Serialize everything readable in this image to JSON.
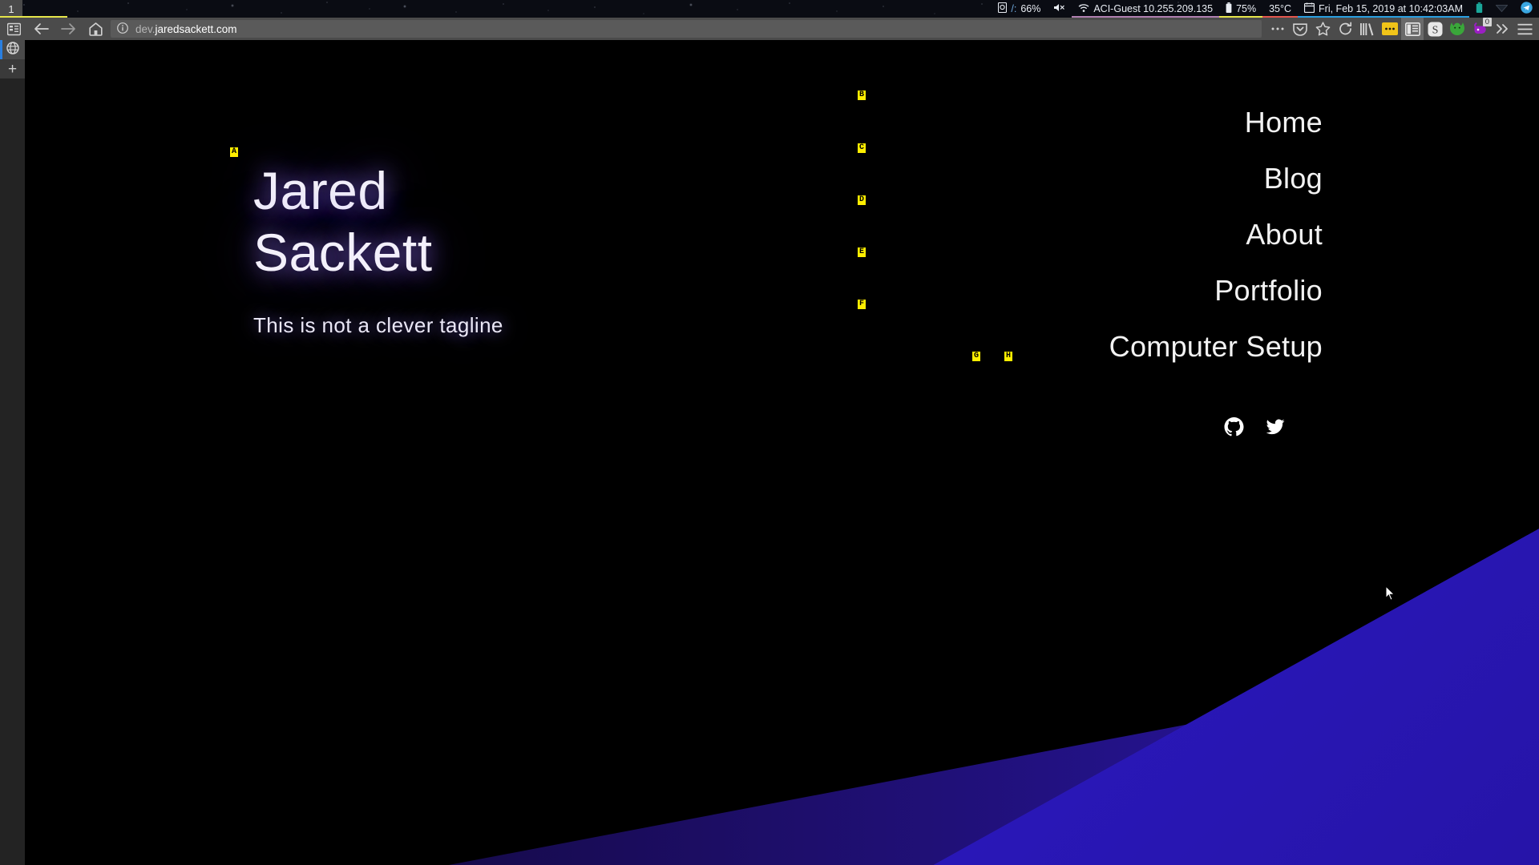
{
  "system_bar": {
    "workspace": "1",
    "modules": [
      {
        "name": "disk",
        "icon": "disk-icon",
        "prefix": "/:",
        "text": "66%",
        "underline": ""
      },
      {
        "name": "volume-muted",
        "icon": "speaker-muted-icon",
        "text": "",
        "underline": ""
      },
      {
        "name": "network",
        "icon": "wifi-icon",
        "text": "ACI-Guest 10.255.209.135",
        "underline": "#b07fb0"
      },
      {
        "name": "battery",
        "icon": "battery-icon",
        "text": "75%",
        "underline": "#e5e54a"
      },
      {
        "name": "temperature",
        "icon": "",
        "text": "35°C",
        "underline": "#e2564e"
      },
      {
        "name": "clock",
        "icon": "calendar-icon",
        "text": "Fri, Feb 15, 2019 at 10:42:03AM",
        "underline": "#2a9fe0"
      },
      {
        "name": "tray-battery",
        "icon": "tray-battery-icon",
        "text": "",
        "underline": ""
      },
      {
        "name": "tray-dropbox",
        "icon": "tray-triangle-icon",
        "text": "",
        "underline": ""
      },
      {
        "name": "tray-telegram",
        "icon": "telegram-icon",
        "text": "",
        "underline": ""
      }
    ]
  },
  "browser": {
    "nav_buttons": [
      {
        "name": "sidebar-toggle-button",
        "icon": "sidebar-icon"
      },
      {
        "name": "back-button",
        "icon": "arrow-left-icon"
      },
      {
        "name": "forward-button",
        "icon": "arrow-right-icon"
      },
      {
        "name": "home-button",
        "icon": "home-icon"
      }
    ],
    "url": {
      "subdomain": "dev.",
      "domain": "jaredsackett.com",
      "full": "dev.jaredsackett.com"
    },
    "identity_icon": "info-circle-icon",
    "toolbar_icons": [
      {
        "name": "page-actions-button",
        "icon": "ellipsis-icon"
      },
      {
        "name": "pocket-button",
        "icon": "pocket-icon"
      },
      {
        "name": "bookmark-button",
        "icon": "star-icon"
      },
      {
        "name": "reload-button",
        "icon": "reload-icon"
      },
      {
        "name": "library-button",
        "icon": "library-icon"
      },
      {
        "name": "extension-yellow-button",
        "icon": "yellow-ellipsis-icon"
      },
      {
        "name": "sidebar-panel-button",
        "icon": "panel-icon",
        "active": true
      },
      {
        "name": "stylus-extension-button",
        "icon": "s-circle-icon"
      },
      {
        "name": "firefox-account-button",
        "icon": "fox-icon"
      },
      {
        "name": "extension-badge-button",
        "icon": "purple-extension-icon",
        "badge": "0"
      },
      {
        "name": "overflow-button",
        "icon": "chevron-double-right-icon"
      },
      {
        "name": "menu-button",
        "icon": "hamburger-icon"
      }
    ],
    "tabstrip": [
      {
        "name": "tab-active",
        "icon": "globe-icon",
        "selected": true
      },
      {
        "name": "new-tab-button",
        "icon": "plus-icon",
        "label": "+"
      }
    ]
  },
  "page": {
    "hero": {
      "title_line1": "Jared",
      "title_line2": "Sackett",
      "tagline": "This is not a clever tagline"
    },
    "nav": [
      {
        "label": "Home",
        "marker": "B"
      },
      {
        "label": "Blog",
        "marker": "C"
      },
      {
        "label": "About",
        "marker": "D"
      },
      {
        "label": "Portfolio",
        "marker": "E"
      },
      {
        "label": "Computer Setup",
        "marker": "F"
      }
    ],
    "social": [
      {
        "name": "github-link",
        "icon": "github-icon",
        "marker": "G"
      },
      {
        "name": "twitter-link",
        "icon": "twitter-icon",
        "marker": "H"
      }
    ],
    "hero_marker": "A",
    "colors": {
      "background": "#000000",
      "accent_purple": "#2e18bd",
      "glow": "#9a78ff",
      "marker": "#ffee00"
    }
  }
}
